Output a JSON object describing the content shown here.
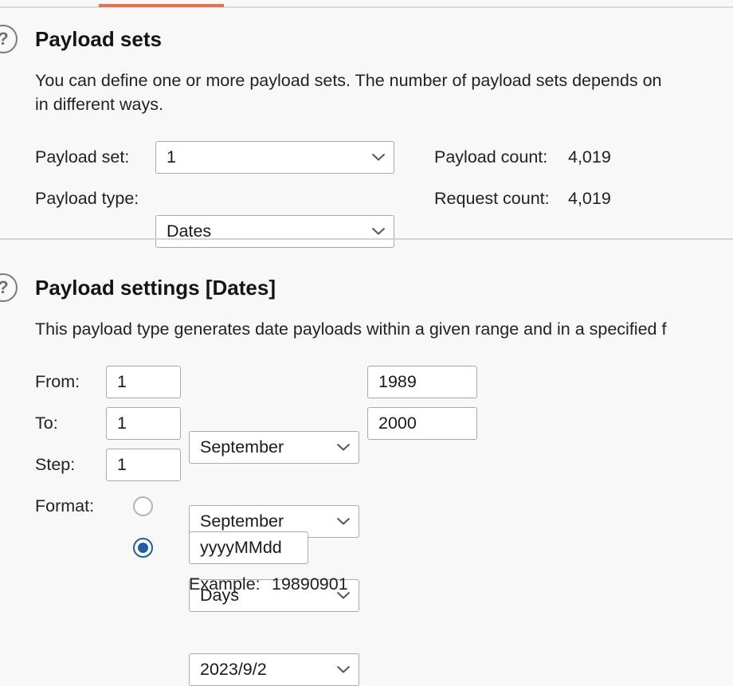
{
  "payload_sets": {
    "title": "Payload sets",
    "desc_line1": "You can define one or more payload sets. The number of payload sets depends on",
    "desc_line2": "in different ways.",
    "set_label": "Payload set:",
    "set_value": "1",
    "type_label": "Payload type:",
    "type_value": "Dates",
    "payload_count_label": "Payload count:",
    "payload_count_value": "4,019",
    "request_count_label": "Request count:",
    "request_count_value": "4,019"
  },
  "payload_settings": {
    "title": "Payload settings [Dates]",
    "desc": "This payload type generates date payloads within a given range and in a specified f",
    "from_label": "From:",
    "from_day": "1",
    "from_month": "September",
    "from_year": "1989",
    "to_label": "To:",
    "to_day": "1",
    "to_month": "September",
    "to_year": "2000",
    "step_label": "Step:",
    "step_value": "1",
    "step_unit": "Days",
    "format_label": "Format:",
    "format_preset": "2023/9/2",
    "format_custom": "yyyyMMdd",
    "example_label": "Example:",
    "example_value": "19890901"
  },
  "icons": {
    "help": "help-icon",
    "dropdown": "chevron-down-icon"
  },
  "colors": {
    "accent": "#e8714a",
    "radio_selected": "#1f5f9f"
  }
}
